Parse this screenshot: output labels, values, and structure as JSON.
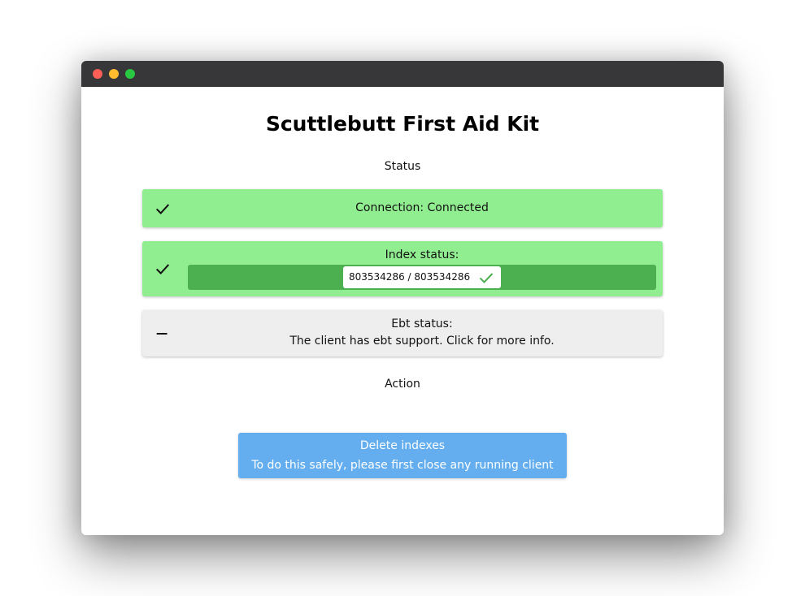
{
  "window": {
    "controls": [
      "close",
      "minimize",
      "maximize"
    ]
  },
  "app": {
    "title": "Scuttlebutt First Aid Kit"
  },
  "status": {
    "label": "Status",
    "connection": {
      "text": "Connection: Connected",
      "icon": "check-icon",
      "state": "ok"
    },
    "index": {
      "label": "Index status:",
      "progress_text": "803534286 / 803534286",
      "progress_fraction": 1.0,
      "icon": "check-icon",
      "state": "ok"
    },
    "ebt": {
      "label": "Ebt status:",
      "message": "The client has ebt support. Click for more info.",
      "icon": "minus-icon",
      "state": "neutral"
    }
  },
  "action": {
    "label": "Action",
    "delete_button": {
      "title": "Delete indexes",
      "subtitle": "To do this safely, please first close any running client"
    }
  },
  "colors": {
    "ok": "#90ee90",
    "progress": "#4caf50",
    "neutral": "#eeeeee",
    "button": "#64aef0",
    "titlebar": "#373739"
  }
}
